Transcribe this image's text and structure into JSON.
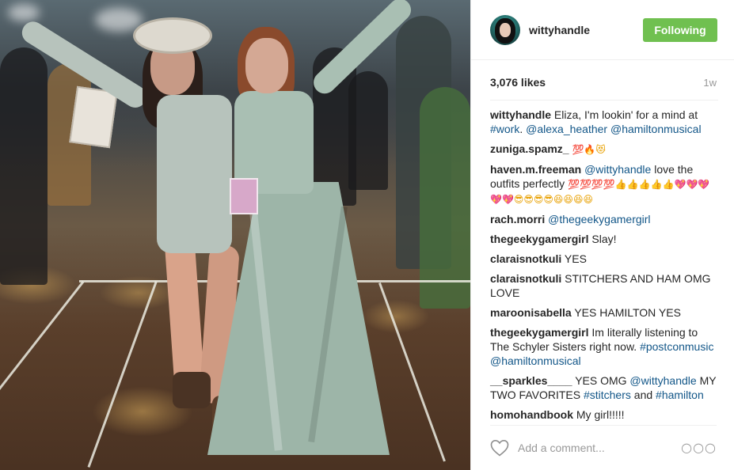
{
  "post": {
    "username": "wittyhandle",
    "follow_label": "Following",
    "likes": "3,076 likes",
    "time_ago": "1w"
  },
  "comments": [
    {
      "user": "wittyhandle",
      "parts": [
        {
          "kind": "text",
          "text": "Eliza, I'm lookin' for a mind at "
        },
        {
          "kind": "tag",
          "text": "#work"
        },
        {
          "kind": "text",
          "text": ". "
        },
        {
          "kind": "tag",
          "text": "@alexa_heather"
        },
        {
          "kind": "text",
          "text": " "
        },
        {
          "kind": "tag",
          "text": "@hamiltonmusical"
        }
      ]
    },
    {
      "user": "zuniga.spamz_",
      "parts": [
        {
          "kind": "emoji",
          "text": "💯🔥😻"
        }
      ]
    },
    {
      "user": "haven.m.freeman",
      "parts": [
        {
          "kind": "tag",
          "text": "@wittyhandle"
        },
        {
          "kind": "text",
          "text": " love the outfits perfectly "
        },
        {
          "kind": "emoji",
          "text": "💯💯💯💯👍👍👍👍👍💖💖💖💖💖😎😎😎😎😆😆😆😆"
        }
      ]
    },
    {
      "user": "rach.morri",
      "parts": [
        {
          "kind": "tag",
          "text": "@thegeekygamergirl"
        }
      ]
    },
    {
      "user": "thegeekygamergirl",
      "parts": [
        {
          "kind": "text",
          "text": "Slay!"
        }
      ]
    },
    {
      "user": "claraisnotkuli",
      "parts": [
        {
          "kind": "text",
          "text": "YES"
        }
      ]
    },
    {
      "user": "claraisnotkuli",
      "parts": [
        {
          "kind": "text",
          "text": "STITCHERS AND HAM OMG LOVE"
        }
      ]
    },
    {
      "user": "maroonisabella",
      "parts": [
        {
          "kind": "text",
          "text": "YES HAMILTON YES"
        }
      ]
    },
    {
      "user": "thegeekygamergirl",
      "parts": [
        {
          "kind": "text",
          "text": "Im literally listening to The Schyler Sisters right now. "
        },
        {
          "kind": "tag",
          "text": "#postconmusic"
        },
        {
          "kind": "text",
          "text": " "
        },
        {
          "kind": "tag",
          "text": "@hamiltonmusical"
        }
      ]
    },
    {
      "user": "__sparkles____",
      "parts": [
        {
          "kind": "text",
          "text": "YES OMG "
        },
        {
          "kind": "tag",
          "text": "@wittyhandle"
        },
        {
          "kind": "text",
          "text": " MY TWO FAVORITES "
        },
        {
          "kind": "tag",
          "text": "#stitchers"
        },
        {
          "kind": "text",
          "text": " and "
        },
        {
          "kind": "tag",
          "text": "#hamilton"
        }
      ]
    },
    {
      "user": "homohandbook",
      "parts": [
        {
          "kind": "text",
          "text": "My girl!!!!!"
        }
      ]
    }
  ],
  "add_comment": {
    "placeholder": "Add a comment...",
    "like_icon": "heart-outline-icon",
    "more_icon": "more-options-icon",
    "more_glyph": "○○○"
  },
  "colors": {
    "following_button": "#70c050",
    "link": "#125688",
    "muted": "#999999"
  }
}
